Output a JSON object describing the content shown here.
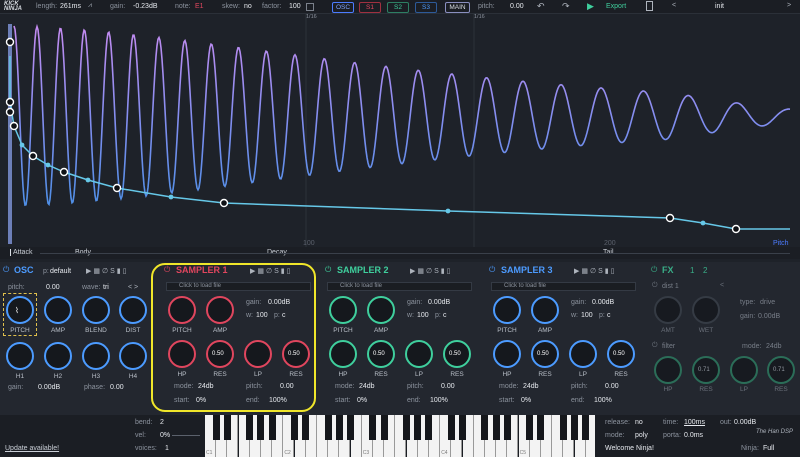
{
  "logo": "KICK NINJA",
  "top": {
    "length_label": "length:",
    "length_value": "261ms",
    "gain_label": "gain:",
    "gain_value": "-0.23dB",
    "note_label": "note:",
    "note_value": "E1",
    "skew_label": "skew:",
    "skew_value": "no",
    "factor_label": "factor:",
    "factor_value": "100",
    "grid_a": "1/16",
    "grid_b": "1/16",
    "pitch_label": "pitch:",
    "pitch_value": "0.00",
    "export_label": "Export",
    "preset_name": "init"
  },
  "tabs": [
    "OSC",
    "S1",
    "S2",
    "S3",
    "MAIN"
  ],
  "sections": [
    "Attack",
    "Body",
    "Decay",
    "Tail"
  ],
  "axis": {
    "t100": "100",
    "t200": "200",
    "pitch": "Pitch"
  },
  "osc": {
    "title": "OSC",
    "p_label": "p:",
    "preset": "default",
    "pitch_label": "pitch:",
    "pitch_value": "0.00",
    "wave_label": "wave:",
    "wave_value": "tri",
    "knobs": [
      "PITCH",
      "AMP",
      "BLEND",
      "DIST"
    ],
    "h_knobs": [
      "H1",
      "H2",
      "H3",
      "H4"
    ],
    "gain_label": "gain:",
    "gain_value": "0.00dB",
    "phase_label": "phase:",
    "phase_value": "0.00"
  },
  "samplers": [
    {
      "title": "SAMPLER 1",
      "file": "Click to load file",
      "gain_label": "gain:",
      "gain_value": "0.00dB",
      "w_label": "w:",
      "w_value": "100",
      "p_label": "p:",
      "p_value": "c",
      "k1": "PITCH",
      "k2": "AMP",
      "k3": "HP",
      "k4": "RES",
      "k5": "LP",
      "k6": "RES",
      "res_a": "0.50",
      "res_b": "0.50",
      "mode_label": "mode:",
      "mode_value": "24db",
      "pitch_label": "pitch:",
      "pitch_value": "0.00",
      "start_label": "start:",
      "start_value": "0%",
      "end_label": "end:",
      "end_value": "100%",
      "color": "#e0465e"
    },
    {
      "title": "SAMPLER 2",
      "file": "Click to load file",
      "gain_label": "gain:",
      "gain_value": "0.00dB",
      "w_label": "w:",
      "w_value": "100",
      "p_label": "p:",
      "p_value": "c",
      "k1": "PITCH",
      "k2": "AMP",
      "k3": "HP",
      "k4": "RES",
      "k5": "LP",
      "k6": "RES",
      "res_a": "0.50",
      "res_b": "0.50",
      "mode_label": "mode:",
      "mode_value": "24db",
      "pitch_label": "pitch:",
      "pitch_value": "0.00",
      "start_label": "start:",
      "start_value": "0%",
      "end_label": "end:",
      "end_value": "100%",
      "color": "#3fcf9d"
    },
    {
      "title": "SAMPLER 3",
      "file": "Click to load file",
      "gain_label": "gain:",
      "gain_value": "0.00dB",
      "w_label": "w:",
      "w_value": "100",
      "p_label": "p:",
      "p_value": "c",
      "k1": "PITCH",
      "k2": "AMP",
      "k3": "HP",
      "k4": "RES",
      "k5": "LP",
      "k6": "RES",
      "res_a": "0.50",
      "res_b": "0.50",
      "mode_label": "mode:",
      "mode_value": "24db",
      "pitch_label": "pitch:",
      "pitch_value": "0.00",
      "start_label": "start:",
      "start_value": "0%",
      "end_label": "end:",
      "end_value": "100%",
      "color": "#4c9bff"
    }
  ],
  "fx": {
    "title": "FX",
    "n1": "1",
    "n2": "2",
    "dist_label": "dist 1",
    "type_label": "type:",
    "type_value": "drive",
    "gain_label": "gain:",
    "gain_value": "0.00dB",
    "amt": "AMT",
    "wet": "WET",
    "filter_label": "filter",
    "mode_label": "mode:",
    "mode_value": "24db",
    "k_hp": "HP",
    "k_res": "RES",
    "k_lp": "LP",
    "k_res2": "RES",
    "res_a": "0.71",
    "res_b": "0.71"
  },
  "bottom": {
    "bend_label": "bend:",
    "bend_value": "2",
    "vel_label": "vel:",
    "vel_value": "0%",
    "voices_label": "voices:",
    "voices_value": "1",
    "update": "Update available!",
    "c1": "C1",
    "c2": "C2",
    "c3": "C3",
    "c4": "C4",
    "c5": "C5",
    "release_label": "release:",
    "release_value": "no",
    "mode_label": "mode:",
    "mode_value": "poly",
    "welcome": "Welcome Ninja!",
    "time_label": "time:",
    "time_value": "100ms",
    "porta_label": "porta:",
    "porta_value": "0.0ms",
    "out_label": "out:",
    "out_value": "0.00dB",
    "ninja_label": "Ninja:",
    "ninja_value": "Full",
    "brand": "The Han DSP"
  }
}
